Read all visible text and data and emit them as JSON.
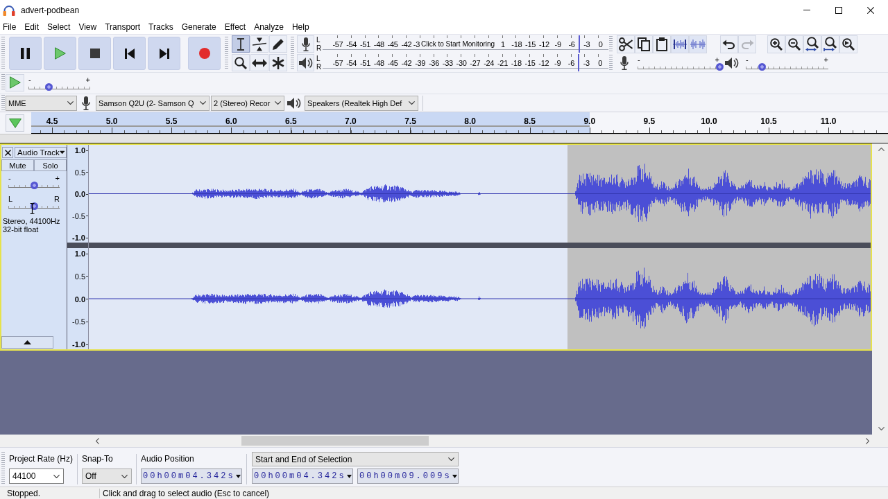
{
  "window": {
    "title": "advert-podbean"
  },
  "menu": [
    "File",
    "Edit",
    "Select",
    "View",
    "Transport",
    "Tracks",
    "Generate",
    "Effect",
    "Analyze",
    "Help"
  ],
  "tools": [
    {
      "selected": true
    },
    {
      "selected": false
    },
    {
      "selected": false
    },
    {
      "selected": false
    },
    {
      "selected": false
    },
    {
      "selected": false
    }
  ],
  "record_meter": {
    "channels": [
      "L",
      "R"
    ],
    "scale_start": [
      "-57",
      "-54",
      "-51",
      "-48",
      "-45",
      "-42",
      "-3"
    ],
    "message": "Click to Start Monitoring",
    "scale_end": [
      "1",
      "-18",
      "-15",
      "-12",
      "-9",
      "-6",
      "-3",
      "0"
    ]
  },
  "playback_meter": {
    "channels": [
      "L",
      "R"
    ],
    "scale": [
      "-57",
      "-54",
      "-51",
      "-48",
      "-45",
      "-42",
      "-39",
      "-36",
      "-33",
      "-30",
      "-27",
      "-24",
      "-21",
      "-18",
      "-15",
      "-12",
      "-9",
      "-6",
      "-3",
      "0"
    ]
  },
  "history": [
    {
      "disabled": false
    },
    {
      "disabled": true
    }
  ],
  "mixer": {
    "record": {
      "min": "-",
      "max": "+",
      "level": 1
    },
    "playback": {
      "min": "-",
      "max": "+",
      "level": 0.2
    }
  },
  "play_at_speed": {
    "min": "-",
    "max": "+",
    "level": 0.33
  },
  "devices": {
    "host": "MME",
    "recording_device": "Samson Q2U (2- Samson Q",
    "recording_channels": "2 (Stereo) Recor",
    "playback_device": "Speakers (Realtek High Def"
  },
  "ruler": {
    "labels": [
      {
        "label": "4.5",
        "selected": true
      },
      {
        "label": "5.0",
        "selected": true
      },
      {
        "label": "5.5",
        "selected": true
      },
      {
        "label": "6.0",
        "selected": true
      },
      {
        "label": "6.5",
        "selected": true
      },
      {
        "label": "7.0",
        "selected": true
      },
      {
        "label": "7.5",
        "selected": true
      },
      {
        "label": "8.0",
        "selected": true
      },
      {
        "label": "8.5",
        "selected": true
      },
      {
        "label": "9.0",
        "selected": true
      },
      {
        "label": "9.5",
        "selected": false
      },
      {
        "label": "10.0",
        "selected": false
      },
      {
        "label": "10.5",
        "selected": false
      },
      {
        "label": "11.0",
        "selected": false
      }
    ]
  },
  "track": {
    "name": "Audio Track",
    "focused": true,
    "mute": {
      "label": "Mute",
      "on": false
    },
    "solo": {
      "label": "Solo",
      "on": false
    },
    "gain": {
      "min": "-",
      "max": "+",
      "level": 0.5
    },
    "pan": {
      "min": "L",
      "max": "R",
      "level": 0.5
    },
    "info": [
      "Stereo, 44100Hz",
      "32-bit float"
    ],
    "channels": [
      {
        "scale": [
          "1.0",
          "0.5",
          "0.0",
          "-0.5",
          "-1.0"
        ]
      },
      {
        "scale": [
          "1.0",
          "0.5",
          "0.0",
          "-0.5",
          "-1.0"
        ]
      }
    ]
  },
  "selection_toolbar": {
    "project_rate": {
      "label": "Project Rate (Hz)",
      "value": "44100"
    },
    "snap_to": {
      "label": "Snap-To",
      "value": "Off"
    },
    "audio_position": {
      "label": "Audio Position",
      "value": "00h00m04.342s"
    },
    "mode": "Start and End of Selection",
    "start": "00h00m04.342s",
    "end": "00h00m09.009s"
  },
  "status_bar": {
    "state": "Stopped.",
    "hint": "Click and drag to select audio (Esc to cancel)"
  }
}
